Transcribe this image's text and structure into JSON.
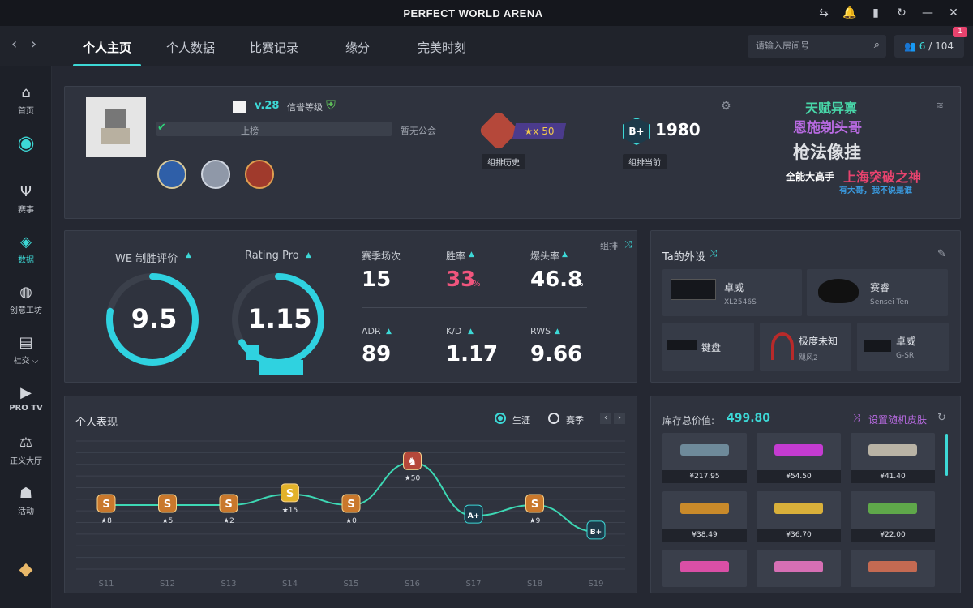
{
  "app": {
    "title": "PERFECT WORLD ARENA"
  },
  "nav": {
    "tabs": [
      "个人主页",
      "个人数据",
      "比赛记录",
      "缘分",
      "完美时刻"
    ],
    "search_placeholder": "请输入房间号",
    "friends_online": "6",
    "friends_total": "/ 104",
    "notif_count": "1"
  },
  "sidebar": {
    "items": [
      {
        "label": "首页",
        "icon": "home-icon"
      },
      {
        "label": "",
        "icon": "wifi-logo-icon"
      },
      {
        "label": "赛事",
        "icon": "trophy-icon"
      },
      {
        "label": "数据",
        "icon": "data-icon"
      },
      {
        "label": "创意工坊",
        "icon": "planet-icon"
      },
      {
        "label": "社交 ⌵",
        "icon": "chat-icon"
      },
      {
        "label": "PRO TV",
        "icon": "tv-icon"
      },
      {
        "label": "正义大厅",
        "icon": "scale-icon"
      },
      {
        "label": "活动",
        "icon": "activity-icon"
      }
    ]
  },
  "profile": {
    "level": "v.28",
    "credit_label": "信誉等级",
    "leaderboard_text": "上榜",
    "guild": "暂无公会",
    "rank_history_stars": "★x 50",
    "rank_history_label": "组排历史",
    "current_elo": "1980",
    "current_label": "组排当前",
    "taglines": [
      "天赋异禀",
      "恩施剃头哥",
      "枪法像挂",
      "全能大高手",
      "上海突破之神",
      "有大哥，我不说是谁"
    ]
  },
  "stats": {
    "mode_label": "组排",
    "we_label": "WE 制胜评价",
    "we_value": "9.5",
    "we_fraction": 0.78,
    "rating_label": "Rating Pro",
    "rating_value": "1.15",
    "rating_fraction": 0.66,
    "items": [
      {
        "label": "赛季场次",
        "value": "15"
      },
      {
        "label": "胜率",
        "value": "33",
        "unit": "%"
      },
      {
        "label": "爆头率",
        "value": "46.8",
        "unit": "%"
      },
      {
        "label": "ADR",
        "value": "89"
      },
      {
        "label": "K/D",
        "value": "1.17"
      },
      {
        "label": "RWS",
        "value": "9.66"
      }
    ]
  },
  "peripherals": {
    "title": "Ta的外设",
    "items": [
      {
        "name": "卓威",
        "model": "XL2546S"
      },
      {
        "name": "赛睿",
        "model": "Sensei Ten"
      },
      {
        "name": "键盘",
        "model": ""
      },
      {
        "name": "极度未知",
        "model": "飓风2"
      },
      {
        "name": "卓威",
        "model": "G-SR"
      }
    ]
  },
  "performance": {
    "title": "个人表现",
    "radio_career": "生涯",
    "radio_season": "赛季"
  },
  "chart_data": {
    "type": "line",
    "x": [
      "S11",
      "S12",
      "S13",
      "S14",
      "S15",
      "S16",
      "S17",
      "S18",
      "S19"
    ],
    "ranks": [
      "S",
      "S",
      "S",
      "S",
      "S",
      "★",
      "A+",
      "S",
      "B+"
    ],
    "stars": [
      "8",
      "5",
      "2",
      "15",
      "0",
      "50",
      "",
      "9",
      ""
    ],
    "values": [
      6,
      6,
      6,
      7,
      6,
      10,
      5,
      6,
      3.5
    ],
    "ylim": [
      0,
      12
    ]
  },
  "inventory": {
    "label": "库存总价值:",
    "value": "499.80",
    "random_label": "设置随机皮肤",
    "prices": [
      "¥217.95",
      "¥54.50",
      "¥41.40",
      "¥38.49",
      "¥36.70",
      "¥22.00",
      "",
      "",
      ""
    ],
    "colors": [
      "#6e8a9a",
      "#c43bd1",
      "#b9b3a5",
      "#c98a2a",
      "#d9b03a",
      "#5fa84a",
      "#d94fa6",
      "#d66fb4",
      "#c46a52"
    ]
  }
}
